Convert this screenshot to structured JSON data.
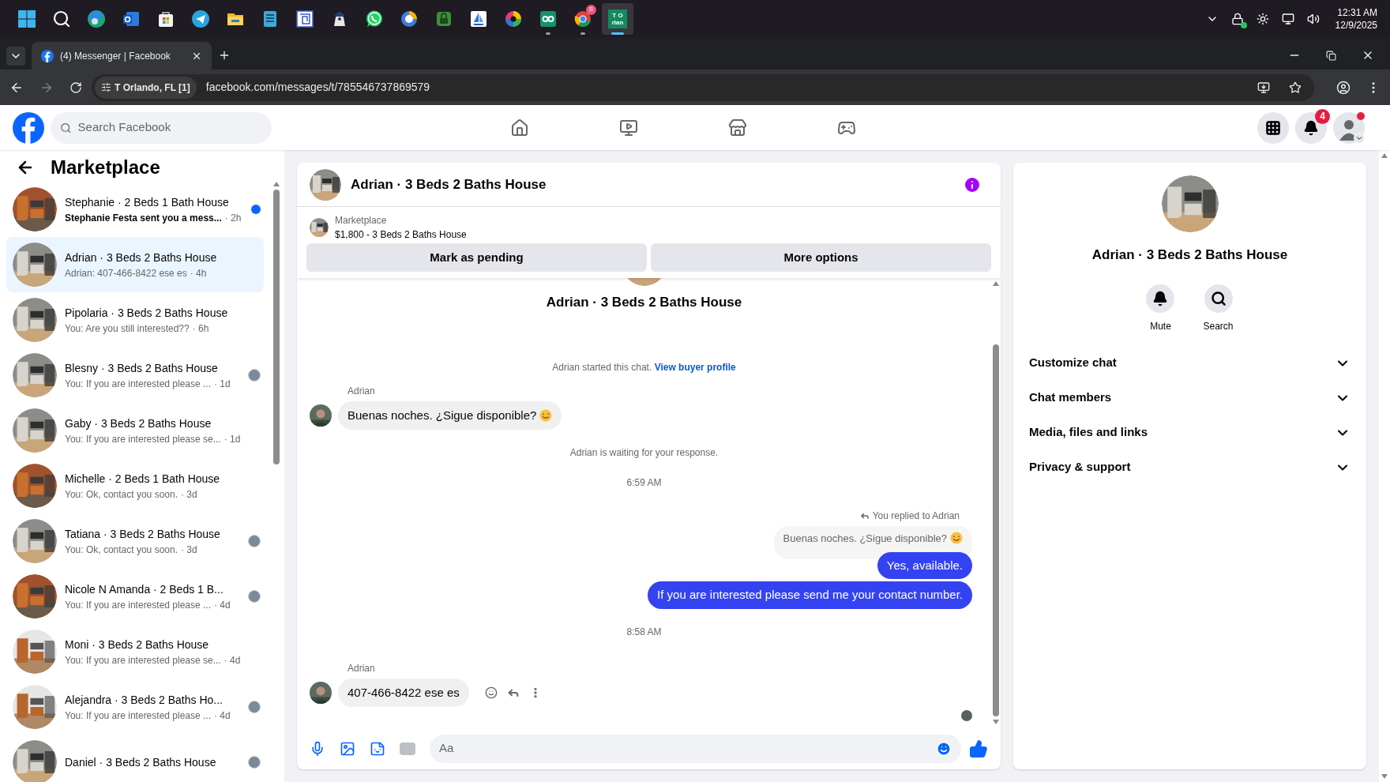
{
  "taskbar": {
    "apps": [
      {
        "kind": "start",
        "running": false,
        "selected": false
      },
      {
        "kind": "search",
        "running": false,
        "selected": false
      },
      {
        "kind": "browser",
        "running": false,
        "selected": false
      },
      {
        "kind": "mail",
        "running": false,
        "selected": false
      },
      {
        "kind": "store",
        "running": false,
        "selected": false
      },
      {
        "kind": "paper-plane",
        "running": false,
        "selected": false
      },
      {
        "kind": "folder",
        "running": false,
        "selected": false
      },
      {
        "kind": "notepad",
        "running": false,
        "selected": false
      },
      {
        "kind": "maze",
        "running": false,
        "selected": false
      },
      {
        "kind": "figure",
        "running": false,
        "selected": false
      },
      {
        "kind": "phone-chat",
        "running": false,
        "selected": false
      },
      {
        "kind": "ring",
        "running": false,
        "selected": false
      },
      {
        "kind": "lock",
        "running": false,
        "selected": false
      },
      {
        "kind": "sailboat",
        "running": false,
        "selected": false
      },
      {
        "kind": "color-wheel",
        "running": false,
        "selected": false
      },
      {
        "kind": "loop",
        "running": true,
        "selected": false
      },
      {
        "kind": "chrome",
        "running": true,
        "selected": false,
        "badge": "S"
      },
      {
        "kind": "tile",
        "running": true,
        "selected": true,
        "label_lines": [
          "T O",
          "rlan"
        ]
      }
    ],
    "time": "12:31 AM",
    "date": "12/9/2025"
  },
  "browser": {
    "tab_title": "(4) Messenger | Facebook",
    "site_chip": "T Orlando, FL [1]",
    "url": "facebook.com/messages/t/785546737869579"
  },
  "facebook_nav": {
    "search_placeholder": "Search Facebook",
    "nav": [
      {
        "kind": "home",
        "selected": false
      },
      {
        "kind": "video",
        "selected": false
      },
      {
        "kind": "marketplace",
        "selected": false
      },
      {
        "kind": "gaming",
        "selected": false
      }
    ],
    "notification_count": "4"
  },
  "sidebar": {
    "title": "Marketplace",
    "conversations": [
      {
        "name": "Stephanie · 2 Beds 1 Bath House",
        "preview": "Stephanie Festa sent you a mess...",
        "time": "· 2h",
        "kind": "wood",
        "unread": true,
        "seen": false,
        "selected": false
      },
      {
        "name": "Adrian · 3 Beds 2 Baths House",
        "preview": "Adrian: 407-466-8422 ese es",
        "time": "· 4h",
        "kind": "grey",
        "unread": false,
        "seen": false,
        "selected": true
      },
      {
        "name": "Pipolaria · 3 Beds 2 Baths House",
        "preview": "You: Are you still interested??",
        "time": "· 6h",
        "kind": "grey",
        "unread": false,
        "seen": false,
        "selected": false
      },
      {
        "name": "Blesny · 3 Beds 2 Baths House",
        "preview": "You: If you are interested please ...",
        "time": "· 1d",
        "kind": "grey",
        "unread": false,
        "seen": true,
        "selected": false
      },
      {
        "name": "Gaby · 3 Beds 2 Baths House",
        "preview": "You: If you are interested please se...",
        "time": "· 1d",
        "kind": "grey",
        "unread": false,
        "seen": false,
        "selected": false
      },
      {
        "name": "Michelle · 2 Beds 1 Bath House",
        "preview": "You: Ok, contact you soon.",
        "time": "· 3d",
        "kind": "wood",
        "unread": false,
        "seen": false,
        "selected": false
      },
      {
        "name": "Tatiana · 3 Beds 2 Baths House",
        "preview": "You: Ok, contact you soon.",
        "time": "· 3d",
        "kind": "grey",
        "unread": false,
        "seen": true,
        "selected": false
      },
      {
        "name": "Nicole N Amanda · 2 Beds 1 B...",
        "preview": "You: If you are interested please ...",
        "time": "· 4d",
        "kind": "wood",
        "unread": false,
        "seen": true,
        "selected": false
      },
      {
        "name": "Moni · 3 Beds 2 Baths House",
        "preview": "You: If you are interested please se...",
        "time": "· 4d",
        "kind": "white",
        "unread": false,
        "seen": false,
        "selected": false
      },
      {
        "name": "Alejandra · 3 Beds 2 Baths Ho...",
        "preview": "You: If you are interested please ...",
        "time": "· 4d",
        "kind": "white",
        "unread": false,
        "seen": true,
        "selected": false
      },
      {
        "name": "Daniel · 3 Beds 2 Baths House",
        "kind": "grey",
        "unread": false,
        "seen": true,
        "selected": false
      }
    ]
  },
  "chat": {
    "title": "Adrian · 3 Beds 2 Baths House",
    "listing": {
      "label": "Marketplace",
      "title": "$1,800 - 3 Beds 2 Baths House"
    },
    "actions": [
      "Mark as pending",
      "More options"
    ],
    "intro_title": "Adrian · 3 Beds 2 Baths House",
    "intro_text": "Adrian started this chat.",
    "intro_link": "View buyer profile",
    "messages": [
      {
        "kind": "sender",
        "text": "Adrian"
      },
      {
        "kind": "incoming",
        "text": "Buenas noches. ¿Sigue disponible?",
        "emoji": true,
        "avatar": true
      },
      {
        "kind": "notice",
        "text": "Adrian is waiting for your response."
      },
      {
        "kind": "timestamp",
        "text": "6:59 AM"
      },
      {
        "kind": "reply_note",
        "text": "You replied to Adrian"
      },
      {
        "kind": "quoted",
        "text": "Buenas noches. ¿Sigue disponible?",
        "emoji": true
      },
      {
        "kind": "outgoing",
        "text": "Yes, available."
      },
      {
        "kind": "outgoing",
        "text": "If you are interested please send me your contact number."
      },
      {
        "kind": "timestamp",
        "text": "8:58 AM"
      },
      {
        "kind": "sender",
        "text": "Adrian"
      },
      {
        "kind": "incoming",
        "text": "407-466-8422  ese es",
        "emoji": false,
        "avatar": true,
        "hover_actions": true
      }
    ],
    "seen": true,
    "composer_placeholder": "Aa"
  },
  "details": {
    "title": "Adrian · 3 Beds 2 Baths House",
    "actions": [
      {
        "kind": "mute",
        "label": "Mute"
      },
      {
        "kind": "search",
        "label": "Search"
      }
    ],
    "sections": [
      {
        "label": "Customize chat",
        "expanded": false
      },
      {
        "label": "Chat members",
        "expanded": false
      },
      {
        "label": "Media, files and links",
        "expanded": false
      },
      {
        "label": "Privacy & support",
        "expanded": false
      }
    ]
  }
}
